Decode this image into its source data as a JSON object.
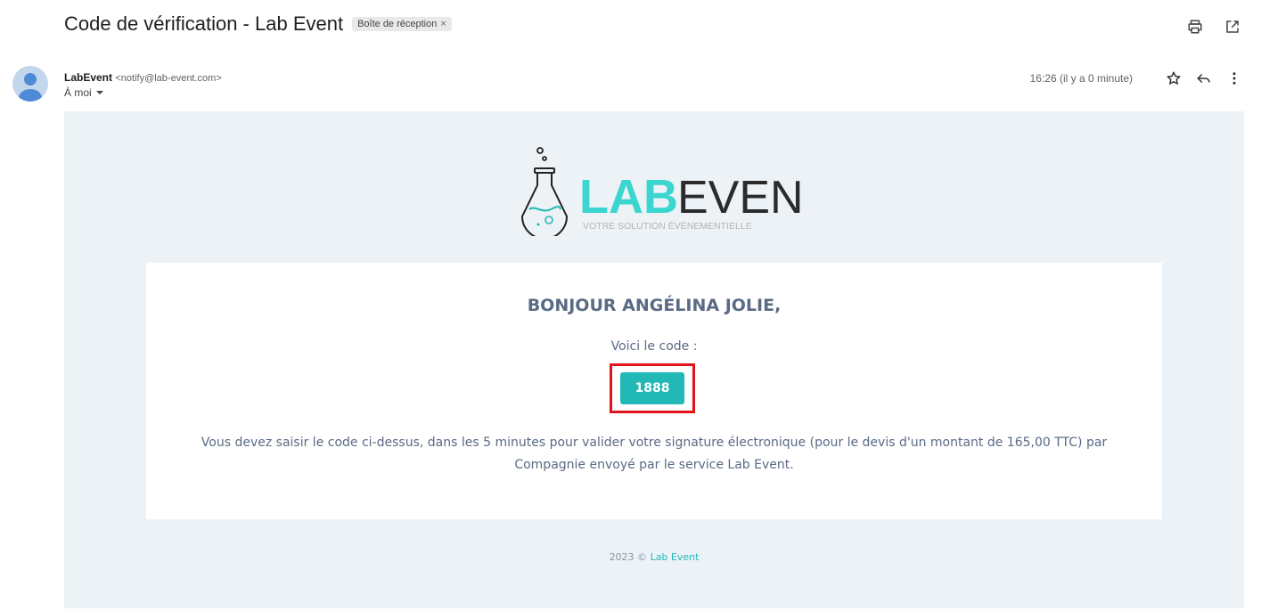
{
  "header": {
    "subject": "Code de vérification - Lab Event",
    "label": "Boîte de réception",
    "label_close": "×"
  },
  "toolbar": {
    "print_icon": "print-icon",
    "open_new_window_icon": "open-in-new-icon"
  },
  "message_meta": {
    "sender_name": "LabEvent",
    "sender_email": "<notify@lab-event.com>",
    "recipient": "À moi",
    "timestamp": "16:26 (il y a 0 minute)"
  },
  "logo": {
    "brand_bold": "LAB",
    "brand_light": "EVENT",
    "tagline": "VOTRE SOLUTION ÉVÉNEMENTIELLE"
  },
  "card": {
    "greeting": "BONJOUR ANGÉLINA JOLIE,",
    "intro": "Voici le code :",
    "code": "1888",
    "message": "Vous devez saisir le code ci-dessus, dans les 5 minutes pour valider votre signature électronique (pour le devis d'un montant de 165,00 TTC) par Compagnie envoyé par le service Lab Event."
  },
  "footer": {
    "copyright": "2023 ©",
    "link_text": "Lab Event"
  },
  "colors": {
    "accent": "#21b8b6",
    "highlight_border": "#e0141a",
    "body_bg": "#edf2f6",
    "text_muted": "#5a6a85"
  }
}
